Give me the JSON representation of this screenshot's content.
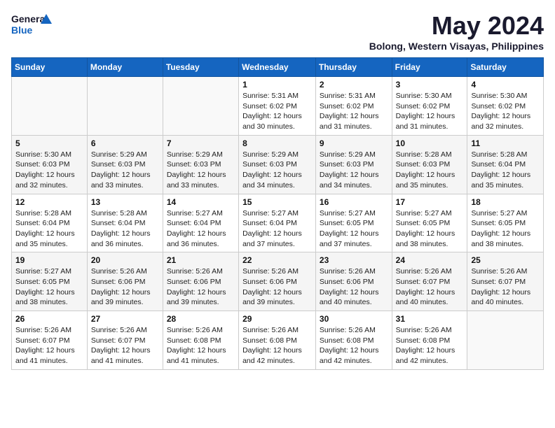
{
  "logo": {
    "line1": "General",
    "line2": "Blue"
  },
  "title": "May 2024",
  "location": "Bolong, Western Visayas, Philippines",
  "days_of_week": [
    "Sunday",
    "Monday",
    "Tuesday",
    "Wednesday",
    "Thursday",
    "Friday",
    "Saturday"
  ],
  "weeks": [
    [
      {
        "num": "",
        "info": ""
      },
      {
        "num": "",
        "info": ""
      },
      {
        "num": "",
        "info": ""
      },
      {
        "num": "1",
        "info": "Sunrise: 5:31 AM\nSunset: 6:02 PM\nDaylight: 12 hours\nand 30 minutes."
      },
      {
        "num": "2",
        "info": "Sunrise: 5:31 AM\nSunset: 6:02 PM\nDaylight: 12 hours\nand 31 minutes."
      },
      {
        "num": "3",
        "info": "Sunrise: 5:30 AM\nSunset: 6:02 PM\nDaylight: 12 hours\nand 31 minutes."
      },
      {
        "num": "4",
        "info": "Sunrise: 5:30 AM\nSunset: 6:02 PM\nDaylight: 12 hours\nand 32 minutes."
      }
    ],
    [
      {
        "num": "5",
        "info": "Sunrise: 5:30 AM\nSunset: 6:03 PM\nDaylight: 12 hours\nand 32 minutes."
      },
      {
        "num": "6",
        "info": "Sunrise: 5:29 AM\nSunset: 6:03 PM\nDaylight: 12 hours\nand 33 minutes."
      },
      {
        "num": "7",
        "info": "Sunrise: 5:29 AM\nSunset: 6:03 PM\nDaylight: 12 hours\nand 33 minutes."
      },
      {
        "num": "8",
        "info": "Sunrise: 5:29 AM\nSunset: 6:03 PM\nDaylight: 12 hours\nand 34 minutes."
      },
      {
        "num": "9",
        "info": "Sunrise: 5:29 AM\nSunset: 6:03 PM\nDaylight: 12 hours\nand 34 minutes."
      },
      {
        "num": "10",
        "info": "Sunrise: 5:28 AM\nSunset: 6:03 PM\nDaylight: 12 hours\nand 35 minutes."
      },
      {
        "num": "11",
        "info": "Sunrise: 5:28 AM\nSunset: 6:04 PM\nDaylight: 12 hours\nand 35 minutes."
      }
    ],
    [
      {
        "num": "12",
        "info": "Sunrise: 5:28 AM\nSunset: 6:04 PM\nDaylight: 12 hours\nand 35 minutes."
      },
      {
        "num": "13",
        "info": "Sunrise: 5:28 AM\nSunset: 6:04 PM\nDaylight: 12 hours\nand 36 minutes."
      },
      {
        "num": "14",
        "info": "Sunrise: 5:27 AM\nSunset: 6:04 PM\nDaylight: 12 hours\nand 36 minutes."
      },
      {
        "num": "15",
        "info": "Sunrise: 5:27 AM\nSunset: 6:04 PM\nDaylight: 12 hours\nand 37 minutes."
      },
      {
        "num": "16",
        "info": "Sunrise: 5:27 AM\nSunset: 6:05 PM\nDaylight: 12 hours\nand 37 minutes."
      },
      {
        "num": "17",
        "info": "Sunrise: 5:27 AM\nSunset: 6:05 PM\nDaylight: 12 hours\nand 38 minutes."
      },
      {
        "num": "18",
        "info": "Sunrise: 5:27 AM\nSunset: 6:05 PM\nDaylight: 12 hours\nand 38 minutes."
      }
    ],
    [
      {
        "num": "19",
        "info": "Sunrise: 5:27 AM\nSunset: 6:05 PM\nDaylight: 12 hours\nand 38 minutes."
      },
      {
        "num": "20",
        "info": "Sunrise: 5:26 AM\nSunset: 6:06 PM\nDaylight: 12 hours\nand 39 minutes."
      },
      {
        "num": "21",
        "info": "Sunrise: 5:26 AM\nSunset: 6:06 PM\nDaylight: 12 hours\nand 39 minutes."
      },
      {
        "num": "22",
        "info": "Sunrise: 5:26 AM\nSunset: 6:06 PM\nDaylight: 12 hours\nand 39 minutes."
      },
      {
        "num": "23",
        "info": "Sunrise: 5:26 AM\nSunset: 6:06 PM\nDaylight: 12 hours\nand 40 minutes."
      },
      {
        "num": "24",
        "info": "Sunrise: 5:26 AM\nSunset: 6:07 PM\nDaylight: 12 hours\nand 40 minutes."
      },
      {
        "num": "25",
        "info": "Sunrise: 5:26 AM\nSunset: 6:07 PM\nDaylight: 12 hours\nand 40 minutes."
      }
    ],
    [
      {
        "num": "26",
        "info": "Sunrise: 5:26 AM\nSunset: 6:07 PM\nDaylight: 12 hours\nand 41 minutes."
      },
      {
        "num": "27",
        "info": "Sunrise: 5:26 AM\nSunset: 6:07 PM\nDaylight: 12 hours\nand 41 minutes."
      },
      {
        "num": "28",
        "info": "Sunrise: 5:26 AM\nSunset: 6:08 PM\nDaylight: 12 hours\nand 41 minutes."
      },
      {
        "num": "29",
        "info": "Sunrise: 5:26 AM\nSunset: 6:08 PM\nDaylight: 12 hours\nand 42 minutes."
      },
      {
        "num": "30",
        "info": "Sunrise: 5:26 AM\nSunset: 6:08 PM\nDaylight: 12 hours\nand 42 minutes."
      },
      {
        "num": "31",
        "info": "Sunrise: 5:26 AM\nSunset: 6:08 PM\nDaylight: 12 hours\nand 42 minutes."
      },
      {
        "num": "",
        "info": ""
      }
    ]
  ]
}
